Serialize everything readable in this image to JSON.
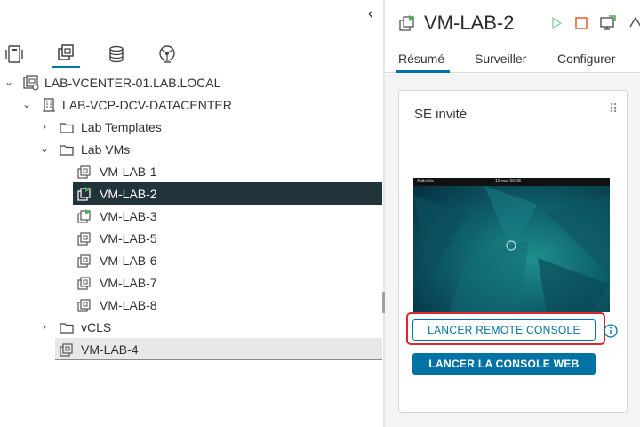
{
  "nav": {
    "collapse_icon": "chevron-left-icon",
    "view_tabs": [
      {
        "icon": "hosts-clusters-icon",
        "active": false
      },
      {
        "icon": "vms-templates-icon",
        "active": true
      },
      {
        "icon": "storage-icon",
        "active": false
      },
      {
        "icon": "networking-icon",
        "active": false
      }
    ],
    "tree": [
      {
        "label": "LAB-VCENTER-01.LAB.LOCAL",
        "icon": "vcenter-icon",
        "caret": "expanded"
      },
      {
        "label": "LAB-VCP-DCV-DATACENTER",
        "icon": "datacenter-icon",
        "caret": "expanded"
      },
      {
        "label": "Lab Templates",
        "icon": "folder-icon",
        "caret": "collapsed"
      },
      {
        "label": "Lab VMs",
        "icon": "folder-icon",
        "caret": "expanded"
      },
      {
        "label": "VM-LAB-1",
        "icon": "vm-off-icon",
        "state": "off"
      },
      {
        "label": "VM-LAB-2",
        "icon": "vm-on-icon",
        "state": "on",
        "selected": true
      },
      {
        "label": "VM-LAB-3",
        "icon": "vm-on-icon",
        "state": "on"
      },
      {
        "label": "VM-LAB-5",
        "icon": "vm-off-icon",
        "state": "off"
      },
      {
        "label": "VM-LAB-6",
        "icon": "vm-off-icon",
        "state": "off"
      },
      {
        "label": "VM-LAB-7",
        "icon": "vm-off-icon",
        "state": "off"
      },
      {
        "label": "VM-LAB-8",
        "icon": "vm-off-icon",
        "state": "off"
      },
      {
        "label": "vCLS",
        "icon": "folder-icon",
        "caret": "collapsed"
      },
      {
        "label": "VM-LAB-4",
        "icon": "vm-off-icon",
        "state": "off",
        "hovered": true
      }
    ]
  },
  "vm": {
    "name": "VM-LAB-2",
    "actions": [
      "power-on-icon",
      "power-off-icon",
      "open-console-icon",
      "migrate-icon"
    ]
  },
  "tabs": [
    {
      "label": "Résumé",
      "active": true
    },
    {
      "label": "Surveiller",
      "active": false
    },
    {
      "label": "Configurer",
      "active": false
    }
  ],
  "guest_card": {
    "title": "SE invité",
    "drag_icon": "drag-handle-icon",
    "screen_bar": {
      "left": "Activités",
      "center": "12 mai 09:48"
    },
    "remote_console_label": "LANCER REMOTE CONSOLE",
    "web_console_label": "LANCER LA CONSOLE WEB",
    "info_icon": "info-circle-icon"
  },
  "colors": {
    "accent": "#0072a3",
    "selected_row": "#21333b",
    "highlight": "#e0262c",
    "power_on": "#4caf50",
    "power_off": "#e05a2b"
  }
}
